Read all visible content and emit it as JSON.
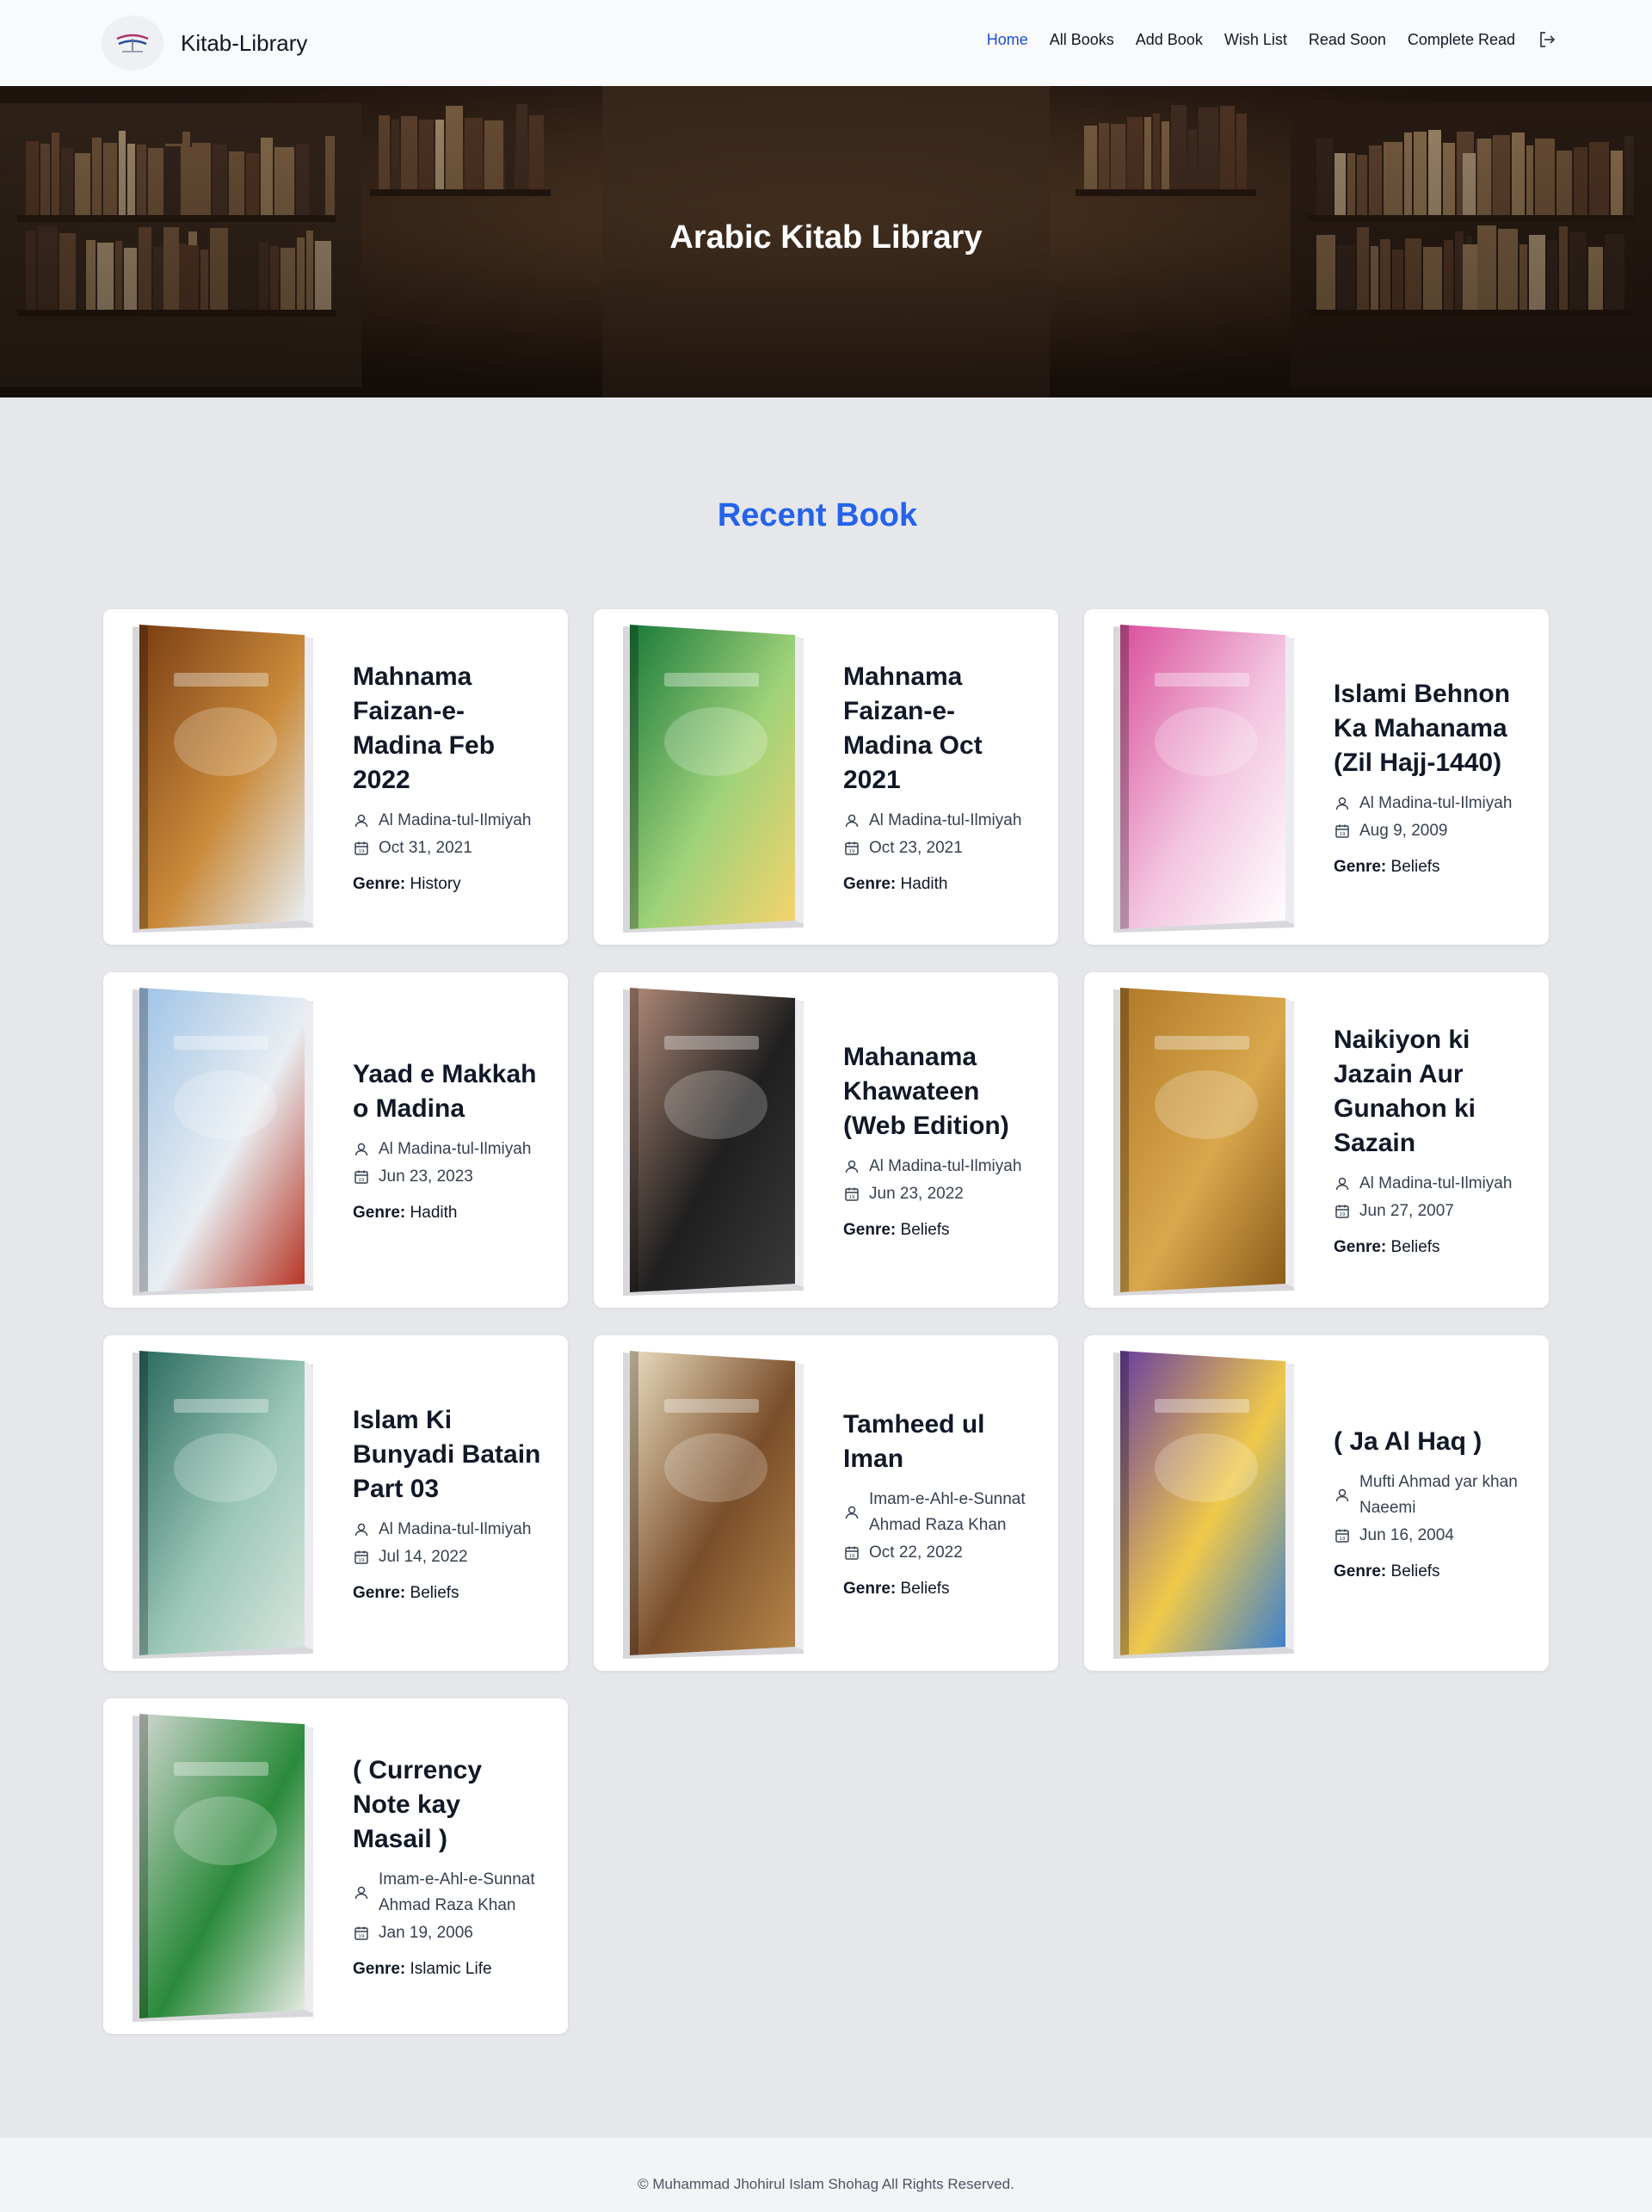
{
  "app": {
    "brand": "Kitab-Library"
  },
  "nav": {
    "links": [
      "Home",
      "All Books",
      "Add Book",
      "Wish List",
      "Read Soon",
      "Complete Read"
    ],
    "active": "Home",
    "logout_icon": "logout-icon"
  },
  "hero": {
    "title": "Arabic Kitab Library"
  },
  "section": {
    "title": "Recent Book"
  },
  "genre_label": "Genre:",
  "books": [
    {
      "title": "Mahnama Faizan-e-Madina Feb 2022",
      "author": "Al Madina-tul-Ilmiyah",
      "date": "Oct 31, 2021",
      "genre": "History",
      "cover_colors": [
        "#7a3e14",
        "#c98a3a",
        "#e8f0f6"
      ]
    },
    {
      "title": "Mahnama Faizan-e-Madina Oct 2021",
      "author": "Al Madina-tul-Ilmiyah",
      "date": "Oct 23, 2021",
      "genre": "Hadith",
      "cover_colors": [
        "#1a7a3a",
        "#9fd27a",
        "#f6d36b"
      ]
    },
    {
      "title": "Islami Behnon Ka Mahanama (Zil Hajj-1440)",
      "author": "Al Madina-tul-Ilmiyah",
      "date": "Aug 9, 2009",
      "genre": "Beliefs",
      "cover_colors": [
        "#d94f9c",
        "#f3c6e0",
        "#ffffff"
      ]
    },
    {
      "title": "Yaad e Makkah o Madina",
      "author": "Al Madina-tul-Ilmiyah",
      "date": "Jun 23, 2023",
      "genre": "Hadith",
      "cover_colors": [
        "#9fc3e6",
        "#e9eef2",
        "#b5301f"
      ]
    },
    {
      "title": "Mahanama Khawateen (Web Edition)",
      "author": "Al Madina-tul-Ilmiyah",
      "date": "Jun 23, 2022",
      "genre": "Beliefs",
      "cover_colors": [
        "#b08a78",
        "#1f1f1f",
        "#3a3a3a"
      ]
    },
    {
      "title": "Naikiyon ki Jazain Aur Gunahon ki Sazain",
      "author": "Al Madina-tul-Ilmiyah",
      "date": "Jun 27, 2007",
      "genre": "Beliefs",
      "cover_colors": [
        "#b07a2a",
        "#d9a74c",
        "#8a5a1a"
      ]
    },
    {
      "title": "Islam Ki Bunyadi Batain Part 03",
      "author": "Al Madina-tul-Ilmiyah",
      "date": "Jul 14, 2022",
      "genre": "Beliefs",
      "cover_colors": [
        "#2a6b5e",
        "#9cc7b8",
        "#d9e6df"
      ]
    },
    {
      "title": "Tamheed ul Iman",
      "author": "Imam-e-Ahl-e-Sunnat Ahmad Raza Khan",
      "date": "Oct 22, 2022",
      "genre": "Beliefs",
      "cover_colors": [
        "#e9dcc0",
        "#7a4e2a",
        "#b8864a"
      ]
    },
    {
      "title": "( Ja Al Haq )",
      "author": "Mufti Ahmad yar khan Naeemi",
      "date": "Jun 16, 2004",
      "genre": "Beliefs",
      "cover_colors": [
        "#6a3fa0",
        "#f0c94a",
        "#3a7fd0"
      ]
    },
    {
      "title": "( Currency Note kay Masail )",
      "author": "Imam-e-Ahl-e-Sunnat Ahmad Raza Khan",
      "date": "Jan 19, 2006",
      "genre": "Islamic Life",
      "cover_colors": [
        "#cfd6cf",
        "#2a8a3a",
        "#e9ece6"
      ]
    }
  ],
  "footer": {
    "text": "© Muhammad Jhohirul Islam Shohag All Rights Reserved."
  }
}
